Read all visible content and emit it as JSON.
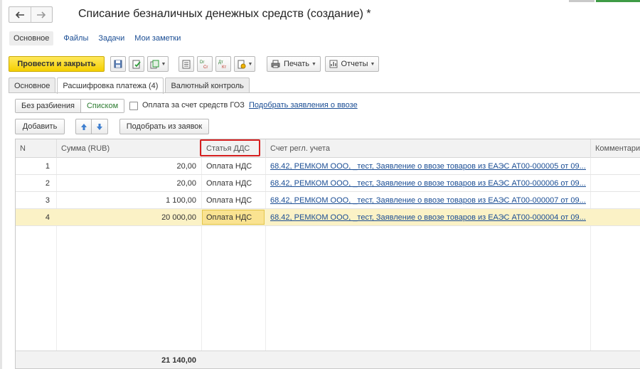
{
  "window": {
    "title": "Списание безналичных денежных средств (создание) *"
  },
  "nav": {
    "back_icon": "arrow-left-icon",
    "forward_icon": "arrow-right-icon"
  },
  "subnav": {
    "items": [
      "Основное",
      "Файлы",
      "Задачи",
      "Мои заметки"
    ]
  },
  "toolbar": {
    "post_close_label": "Провести и закрыть",
    "print_label": "Печать",
    "reports_label": "Отчеты",
    "icons": [
      "save-icon",
      "post-icon",
      "create-based-on-icon",
      "document-journal-icon",
      "dt-cr-movements-icon",
      "dt-kt-icon",
      "attachment-icon",
      "printer-icon",
      "reports-icon"
    ],
    "dt_cr": "Dr Cr",
    "dt_kt": "Дт Кт"
  },
  "tabs": {
    "items": [
      "Основное",
      "Расшифровка платежа (4)",
      "Валютный контроль"
    ],
    "active": "Расшифровка платежа (4)"
  },
  "split": {
    "option1": "Без разбиения",
    "option2": "Списком",
    "selected": "Списком"
  },
  "goz_checkbox": {
    "label": "Оплата за счет средств ГОЗ",
    "checked": false
  },
  "import_link": "Подобрать заявления о ввозе",
  "actions": {
    "add_label": "Добавить",
    "select_from_requests_label": "Подобрать из заявок"
  },
  "table": {
    "columns": [
      "N",
      "Сумма (RUB)",
      "Статья ДДС",
      "Счет регл. учета",
      "Комментарий"
    ],
    "highlighted_column": "Статья ДДС",
    "rows": [
      {
        "n": "1",
        "sum": "20,00",
        "article": "Оплата НДС",
        "account": "68.42, РЕМКОМ ООО, _тест, Заявление о ввозе товаров из ЕАЭС АТ00-000005 от 09...."
      },
      {
        "n": "2",
        "sum": "20,00",
        "article": "Оплата НДС",
        "account": "68.42, РЕМКОМ ООО, _тест, Заявление о ввозе товаров из ЕАЭС АТ00-000006 от 09...."
      },
      {
        "n": "3",
        "sum": "1 100,00",
        "article": "Оплата НДС",
        "account": "68.42, РЕМКОМ ООО, _тест, Заявление о ввозе товаров из ЕАЭС АТ00-000007 от 09...."
      },
      {
        "n": "4",
        "sum": "20 000,00",
        "article": "Оплата НДС",
        "account": "68.42, РЕМКОМ ООО, _тест, Заявление о ввозе товаров из ЕАЭС АТ00-000004 от 09...."
      }
    ],
    "selected_row": "4",
    "total": "21 140,00"
  },
  "colors": {
    "primary_button": "#f4cf00",
    "link": "#1a4d94",
    "highlight_outline": "#d61f1f",
    "selected_row": "#fbf2c6",
    "active_cell": "#fae391",
    "selected_segment_text": "#2e7d32"
  }
}
